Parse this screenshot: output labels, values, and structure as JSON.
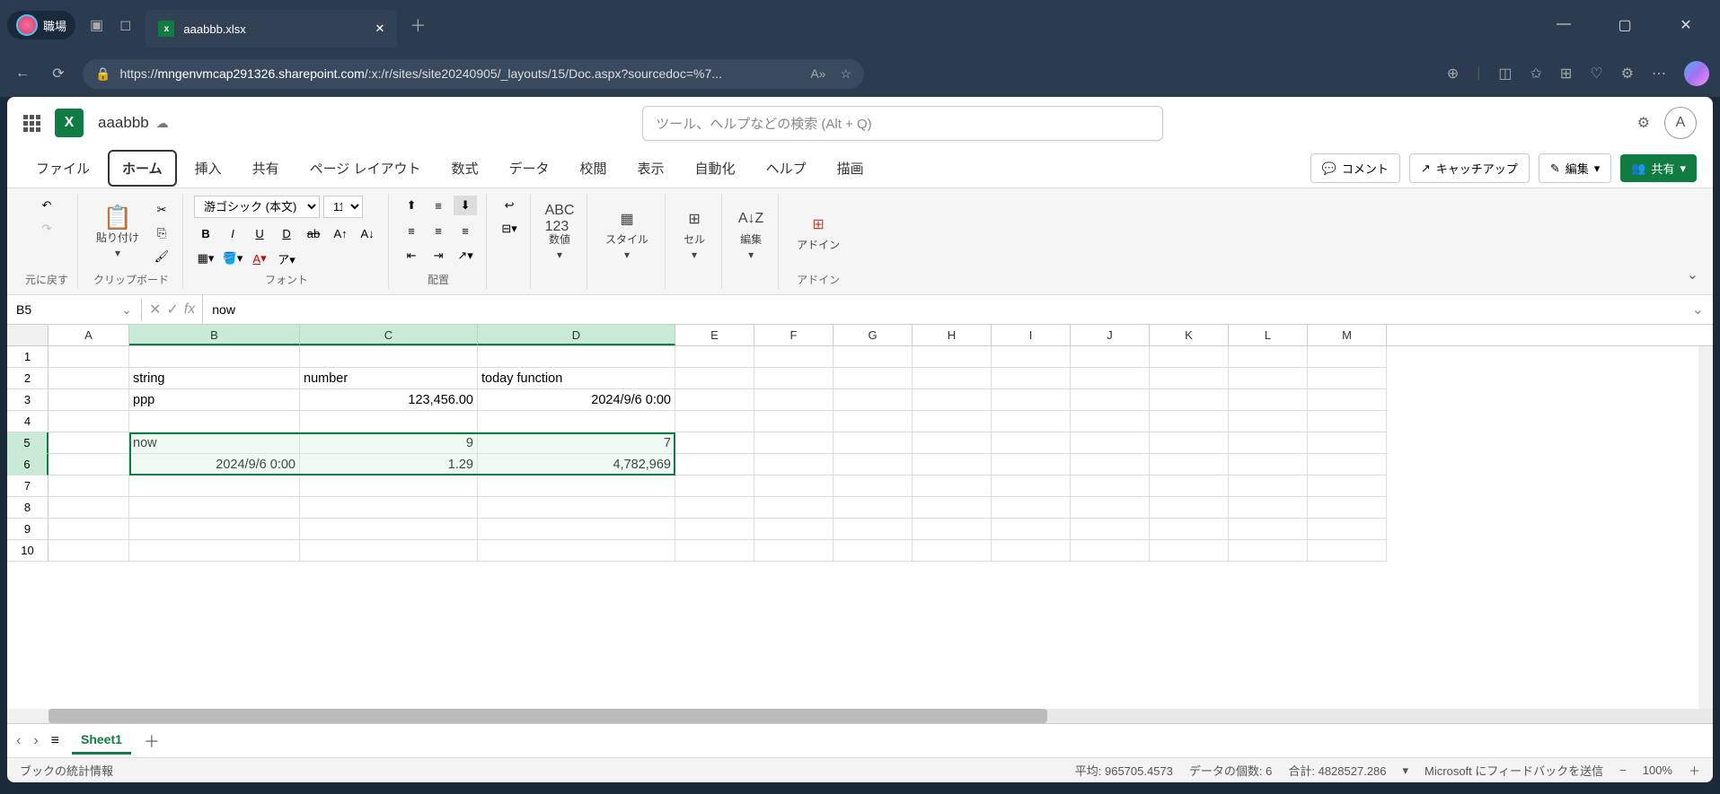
{
  "browser": {
    "profile_label": "職場",
    "tab_title": "aaabbb.xlsx",
    "url_prefix": "https://",
    "url_host": "mngenvmcap291326.sharepoint.com",
    "url_path": "/:x:/r/sites/site20240905/_layouts/15/Doc.aspx?sourcedoc=%7..."
  },
  "excel": {
    "doc_name": "aaabbb",
    "search_placeholder": "ツール、ヘルプなどの検索 (Alt + Q)",
    "user_initial": "A",
    "tabs": {
      "file": "ファイル",
      "home": "ホーム",
      "insert": "挿入",
      "share_tab": "共有",
      "page_layout": "ページ レイアウト",
      "formulas": "数式",
      "data": "データ",
      "review": "校閲",
      "view": "表示",
      "automate": "自動化",
      "help": "ヘルプ",
      "draw": "描画"
    },
    "ribbon_right": {
      "comment": "コメント",
      "catchup": "キャッチアップ",
      "edit": "編集",
      "share": "共有"
    },
    "ribbon_groups": {
      "undo": "元に戻す",
      "clipboard": "クリップボード",
      "paste": "貼り付け",
      "font": "フォント",
      "font_name": "游ゴシック (本文)",
      "font_size": "11",
      "alignment": "配置",
      "number": "数値",
      "styles": "スタイル",
      "cells": "セル",
      "editing": "編集",
      "addins": "アドイン"
    },
    "name_box": "B5",
    "formula_value": "now",
    "columns": [
      "A",
      "B",
      "C",
      "D",
      "E",
      "F",
      "G",
      "H",
      "I",
      "J",
      "K",
      "L",
      "M"
    ],
    "col_widths": {
      "A": 90,
      "B": 190,
      "C": 198,
      "D": 220,
      "default": 88
    },
    "rows": [
      1,
      2,
      3,
      4,
      5,
      6,
      7,
      8,
      9,
      10
    ],
    "cells": {
      "B2": "string",
      "C2": "number",
      "D2": "today function",
      "B3": "ppp",
      "C3": "123,456.00",
      "D3": "2024/9/6 0:00",
      "B5": "now",
      "C5": "9",
      "D5": "7",
      "B6": "2024/9/6 0:00",
      "C6": "1.29",
      "D6": "4,782,969"
    },
    "numeric_cells": [
      "C3",
      "D3",
      "C5",
      "D5",
      "B6",
      "C6",
      "D6"
    ],
    "selected_cols": [
      "B",
      "C",
      "D"
    ],
    "selected_rows": [
      5,
      6
    ],
    "sheet_name": "Sheet1",
    "status": {
      "left": "ブックの統計情報",
      "avg": "平均: 965705.4573",
      "count": "データの個数: 6",
      "sum": "合計: 4828527.286",
      "feedback": "Microsoft にフィードバックを送信",
      "zoom": "100%"
    }
  }
}
